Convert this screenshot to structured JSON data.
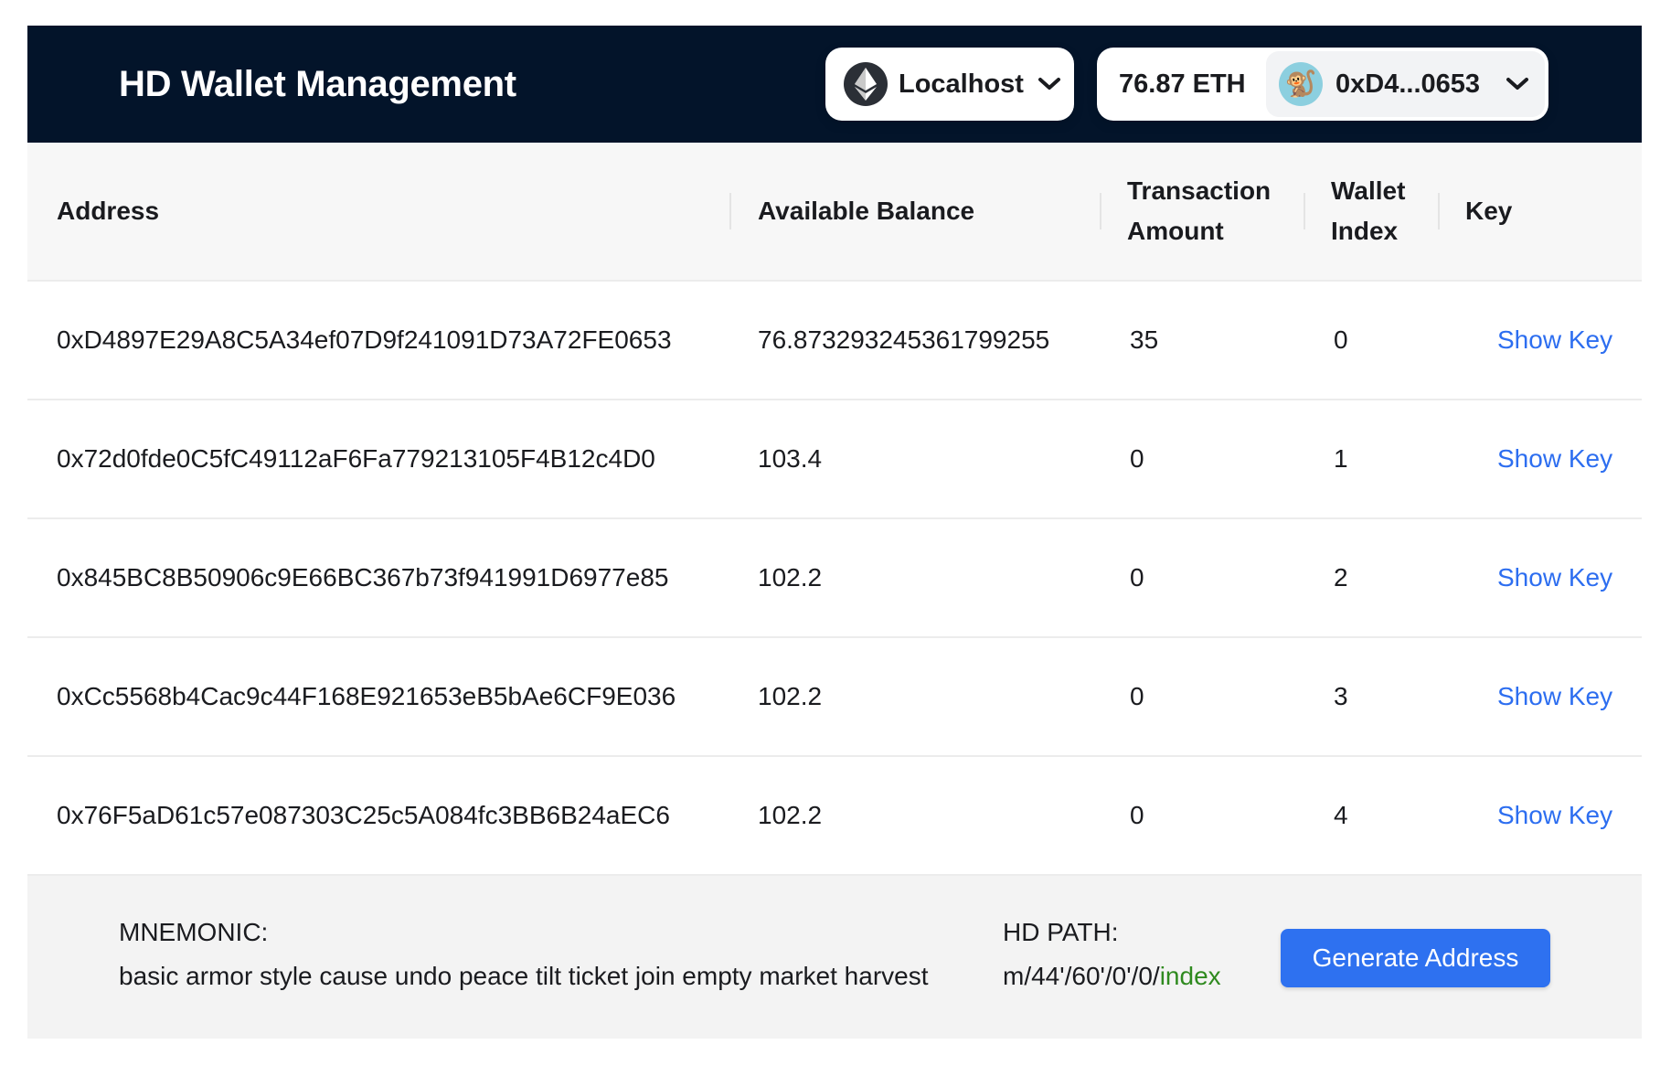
{
  "header": {
    "title": "HD Wallet Management",
    "network": "Localhost",
    "balance": "76.87 ETH",
    "account": "0xD4...0653",
    "avatar_emoji": "🐒"
  },
  "table": {
    "headers": {
      "address": "Address",
      "balance": "Available Balance",
      "tx_amount_line1": "Transaction",
      "tx_amount_line2": "Amount",
      "index_line1": "Wallet",
      "index_line2": "Index",
      "key": "Key"
    },
    "rows": [
      {
        "address": "0xD4897E29A8C5A34ef07D9f241091D73A72FE0653",
        "balance": "76.873293245361799255",
        "tx_amount": "35",
        "index": "0",
        "key_link": "Show Key"
      },
      {
        "address": "0x72d0fde0C5fC49112aF6Fa779213105F4B12c4D0",
        "balance": "103.4",
        "tx_amount": "0",
        "index": "1",
        "key_link": "Show Key"
      },
      {
        "address": "0x845BC8B50906c9E66BC367b73f941991D6977e85",
        "balance": "102.2",
        "tx_amount": "0",
        "index": "2",
        "key_link": "Show Key"
      },
      {
        "address": "0xCc5568b4Cac9c44F168E921653eB5bAe6CF9E036",
        "balance": "102.2",
        "tx_amount": "0",
        "index": "3",
        "key_link": "Show Key"
      },
      {
        "address": "0x76F5aD61c57e087303C25c5A084fc3BB6B24aEC6",
        "balance": "102.2",
        "tx_amount": "0",
        "index": "4",
        "key_link": "Show Key"
      }
    ]
  },
  "footer": {
    "mnemonic_label": "MNEMONIC:",
    "mnemonic": "basic armor style cause undo peace tilt ticket join empty market harvest",
    "hd_path_label": "HD PATH:",
    "hd_path_prefix": "m/44'/60'/0'/0/",
    "hd_path_index": "index",
    "generate_button": "Generate Address"
  },
  "colors": {
    "header_bg": "#03142a",
    "link": "#2d6ef0",
    "button": "#2e71f0",
    "path_index": "#2f8a1f"
  },
  "icons": [
    "ethereum-icon",
    "chevron-down-icon",
    "monkey-avatar-icon"
  ]
}
